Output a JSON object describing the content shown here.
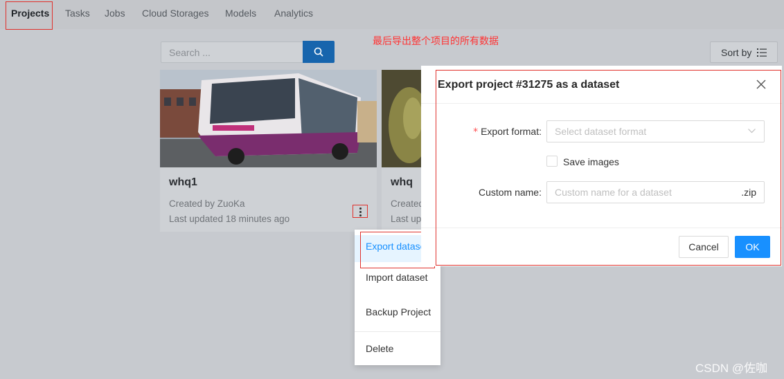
{
  "nav": {
    "items": [
      {
        "label": "Projects",
        "active": true
      },
      {
        "label": "Tasks"
      },
      {
        "label": "Jobs"
      },
      {
        "label": "Cloud Storages"
      },
      {
        "label": "Models"
      },
      {
        "label": "Analytics"
      }
    ]
  },
  "annotation": "最后导出整个项目的所有数据",
  "search": {
    "placeholder": "Search ...",
    "icon": "search-icon"
  },
  "sort": {
    "label": "Sort by",
    "icon": "sort-list-icon"
  },
  "cards": [
    {
      "title": "whq1",
      "created": "Created by ZuoKa",
      "updated": "Last updated 18 minutes ago"
    },
    {
      "title": "whq",
      "created": "Created",
      "updated": "Last up"
    }
  ],
  "menu": {
    "items": [
      "Export dataset",
      "Import dataset",
      "Backup Project",
      "Delete"
    ],
    "selected": "Export dataset"
  },
  "modal": {
    "title": "Export project #31275 as a dataset",
    "format_label": "Export format:",
    "format_placeholder": "Select dataset format",
    "save_images_label": "Save images",
    "save_images_checked": false,
    "custom_name_label": "Custom name:",
    "custom_name_placeholder": "Custom name for a dataset",
    "custom_name_suffix": ".zip",
    "cancel_label": "Cancel",
    "ok_label": "OK"
  },
  "colors": {
    "primary": "#1890ff",
    "annotation_red": "#e0302b",
    "required": "#ff4d4f"
  },
  "watermark": "CSDN @佐咖"
}
